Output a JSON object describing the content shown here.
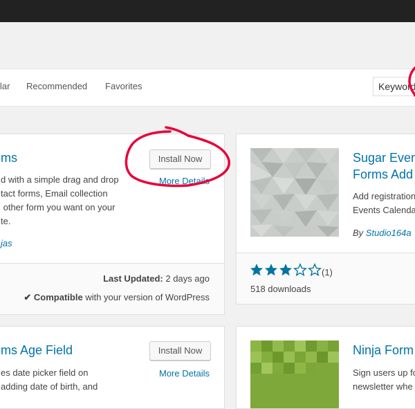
{
  "tabs": [
    "lar",
    "Recommended",
    "Favorites"
  ],
  "search": {
    "value": "Keyword"
  },
  "plugins": [
    {
      "title": "ms",
      "install_label": "Install Now",
      "details_label": "More Details",
      "description": [
        "d with a simple drag and drop",
        "tact forms, Email collection",
        " other form you want on your",
        "te."
      ],
      "author": "jas",
      "last_updated_label": "Last Updated:",
      "last_updated_value": "2 days ago",
      "compatible_label": "Compatible",
      "compatible_rest": "with your version of WordPress"
    },
    {
      "title_lines": [
        "Sugar Even",
        "Forms Add"
      ],
      "description": [
        "Add registration",
        "Events Calendar"
      ],
      "author_prefix": "By",
      "author": "Studio164a",
      "rating": 3,
      "rating_count": "(1)",
      "downloads": "518 downloads"
    },
    {
      "title": "ms Age Field",
      "install_label": "Install Now",
      "details_label": "More Details",
      "description": [
        "es date picker field on",
        "adding date of birth, and"
      ]
    },
    {
      "title": "Ninja Form",
      "description": [
        "Sign users up fo",
        "newsletter whe"
      ]
    }
  ],
  "colors": {
    "link": "#0073aa",
    "star": "#0074a2",
    "annotation": "#e8003a"
  }
}
